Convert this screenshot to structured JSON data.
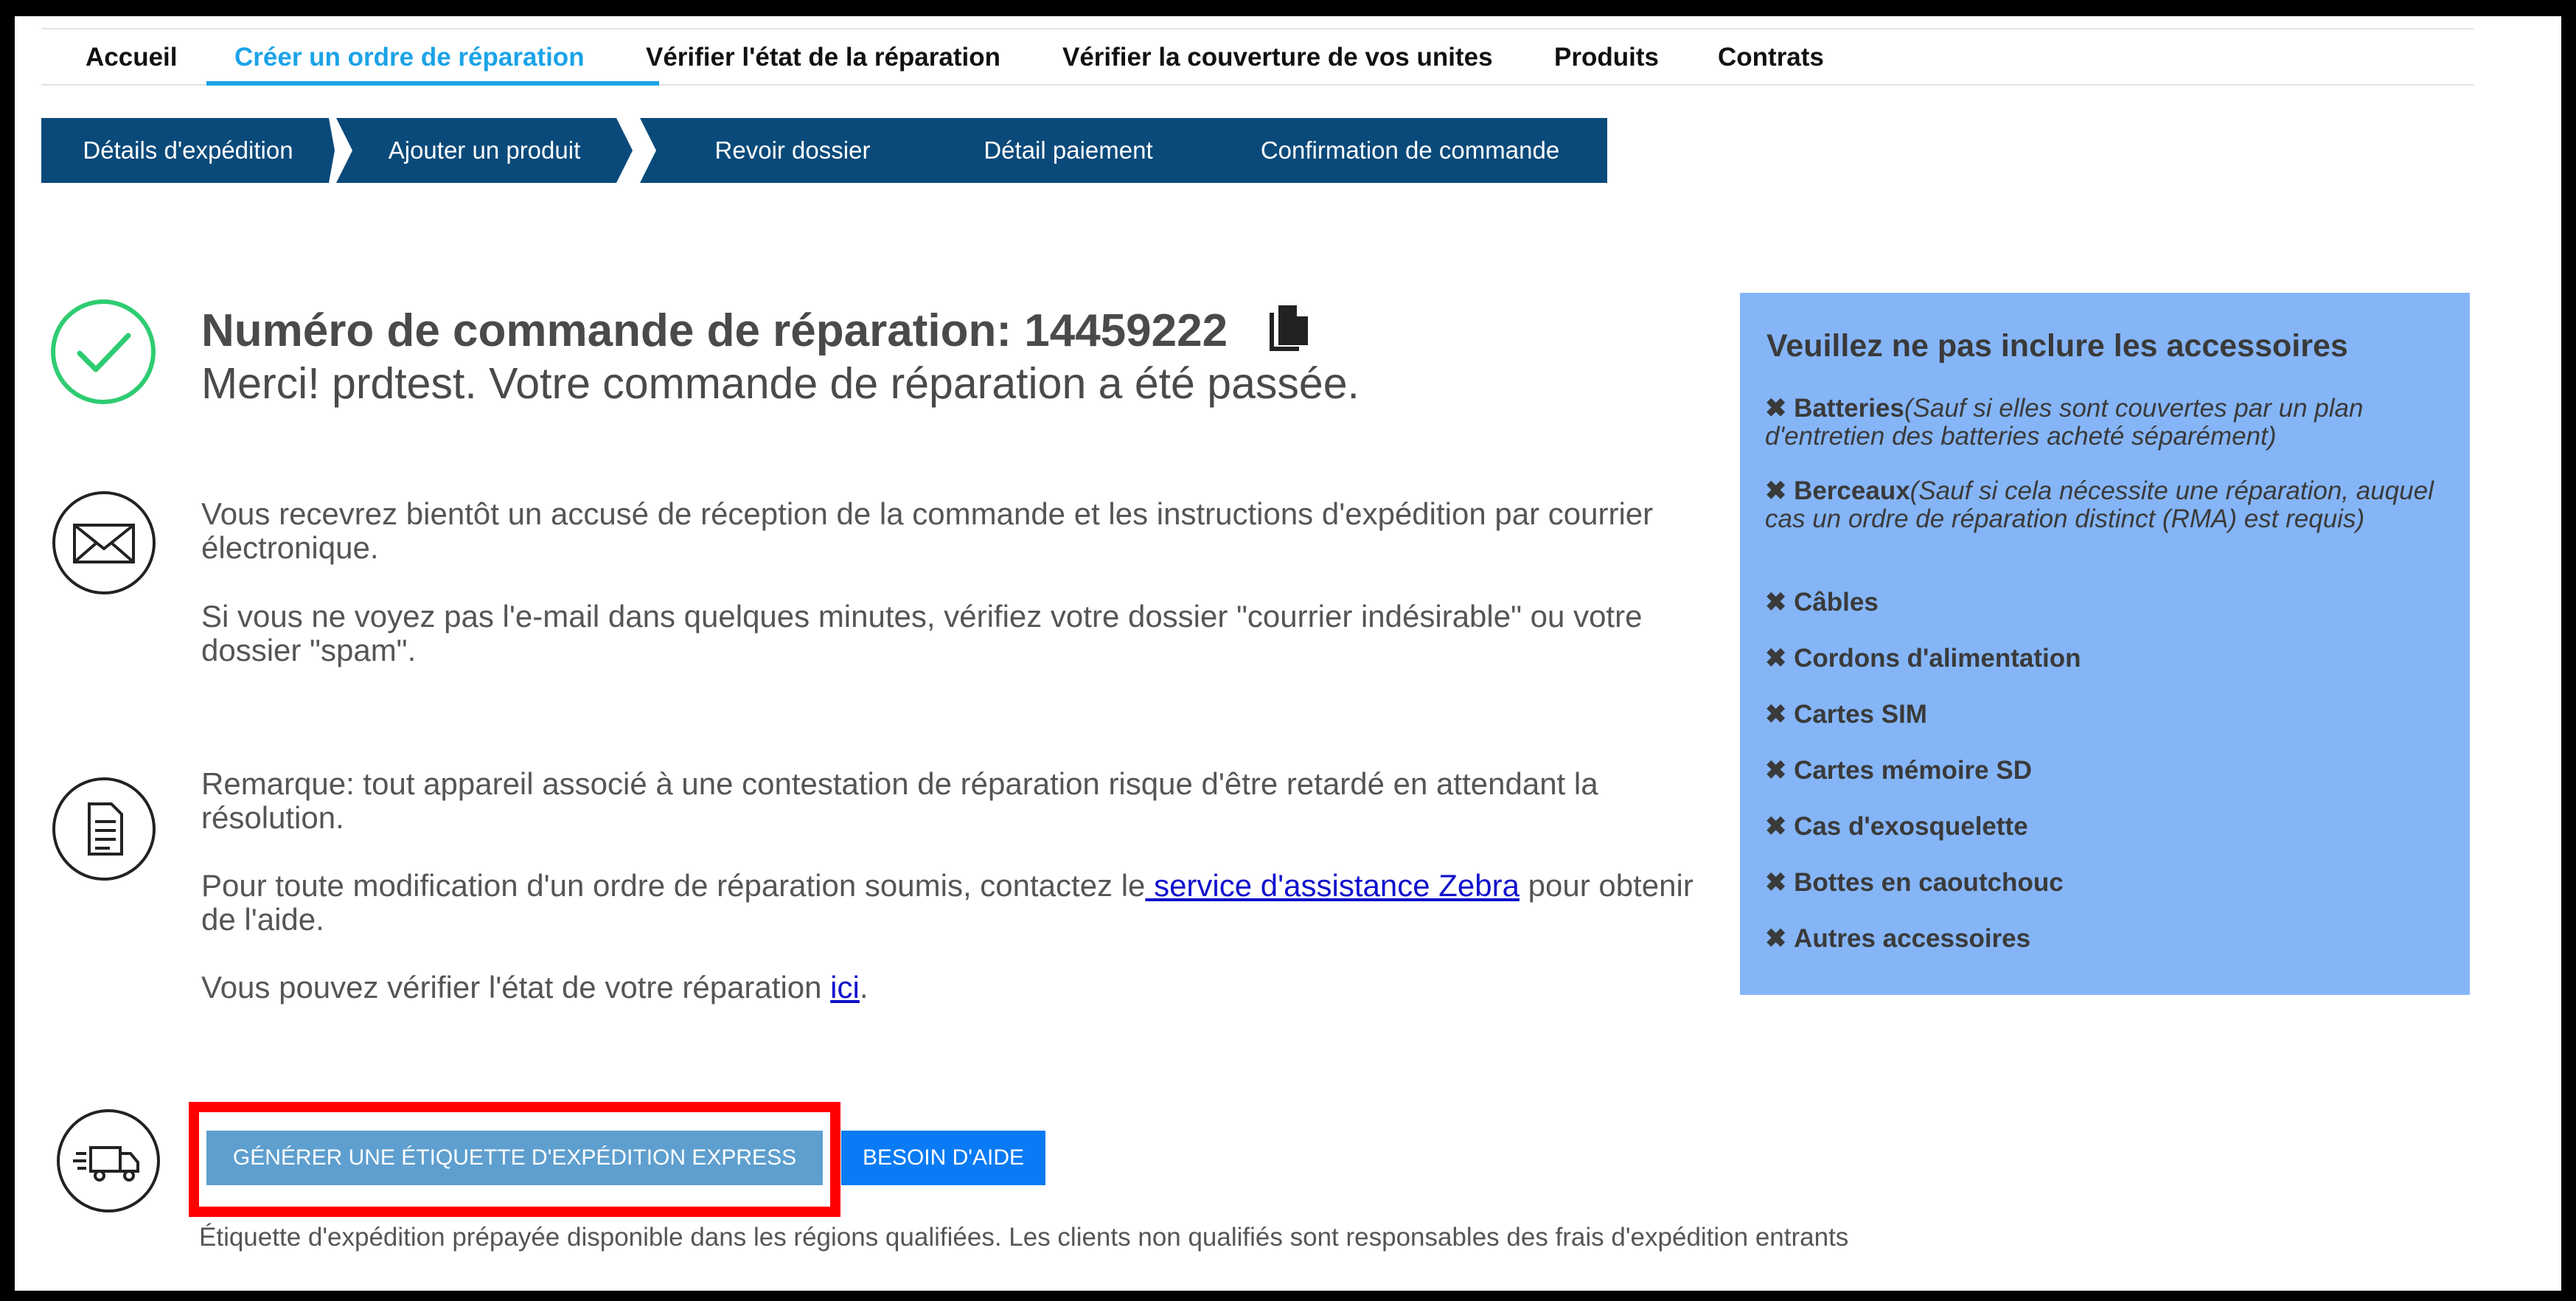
{
  "nav": {
    "items": [
      {
        "label": "Accueil"
      },
      {
        "label": "Créer un ordre de réparation"
      },
      {
        "label": "Vérifier l'état de la réparation"
      },
      {
        "label": "Vérifier la couverture de vos unites"
      },
      {
        "label": "Produits"
      },
      {
        "label": "Contrats"
      }
    ],
    "active_index": 1
  },
  "stepper": {
    "steps": [
      {
        "label": "Détails d'expédition"
      },
      {
        "label": "Ajouter un produit"
      },
      {
        "label": "Revoir dossier"
      },
      {
        "label": "Détail paiement"
      },
      {
        "label": "Confirmation de commande"
      }
    ]
  },
  "confirmation": {
    "heading_prefix": "Numéro de commande de réparation: 14459222",
    "message": "Merci! prdtest. Votre commande de réparation a été passée.",
    "email_note": "Vous recevrez bientôt un accusé de réception de la commande et les instructions d'expédition par courrier électronique.",
    "spam_note": "Si vous ne voyez pas l'e-mail dans quelques minutes, vérifiez votre dossier \"courrier indésirable\" ou votre dossier \"spam\".",
    "remark": "Remarque: tout appareil associé à une contestation de réparation risque d'être retardé en attendant la résolution.",
    "modify_prefix": "Pour toute modification d'un ordre de réparation soumis, contactez le",
    "modify_link": " service d'assistance Zebra",
    "modify_suffix": " pour obtenir de l'aide.",
    "status_prefix": "Vous pouvez vérifier l'état de votre réparation ",
    "status_link": "ici",
    "status_suffix": "."
  },
  "panel": {
    "title": "Veuillez ne pas inclure les accessoires",
    "items": [
      {
        "label": "Batteries",
        "note": "(Sauf si elles sont couvertes par un plan d'entretien des batteries acheté séparément)"
      },
      {
        "label": "Berceaux",
        "note": "(Sauf si cela nécessite une réparation, auquel cas un ordre de réparation distinct (RMA) est requis)"
      },
      {
        "label": "Câbles",
        "note": ""
      },
      {
        "label": "Cordons d'alimentation",
        "note": ""
      },
      {
        "label": "Cartes SIM",
        "note": ""
      },
      {
        "label": "Cartes mémoire SD",
        "note": ""
      },
      {
        "label": "Cas d'exosquelette",
        "note": ""
      },
      {
        "label": "Bottes en caoutchouc",
        "note": ""
      },
      {
        "label": "Autres accessoires",
        "note": ""
      }
    ],
    "bg_color": "#85b5f7"
  },
  "actions": {
    "generate_label": "GÉNÉRER UNE ÉTIQUETTE D'EXPÉDITION EXPRESS",
    "help_label": "BESOIN D'AIDE",
    "footnote": "Étiquette d'expédition prépayée disponible dans les régions qualifiées. Les clients non qualifiés sont responsables des frais d'expédition entrants"
  },
  "icons": {
    "success": "check-circle-icon",
    "email": "envelope-icon",
    "document": "document-icon",
    "shipping": "delivery-truck-icon",
    "copy": "copy-icon",
    "exclude": "x-mark-icon"
  },
  "colors": {
    "accent": "#1aa3e8",
    "step_bg": "#0a4a7a",
    "success": "#2ecc71",
    "highlight": "#ff0000",
    "link": "#1010cc"
  }
}
